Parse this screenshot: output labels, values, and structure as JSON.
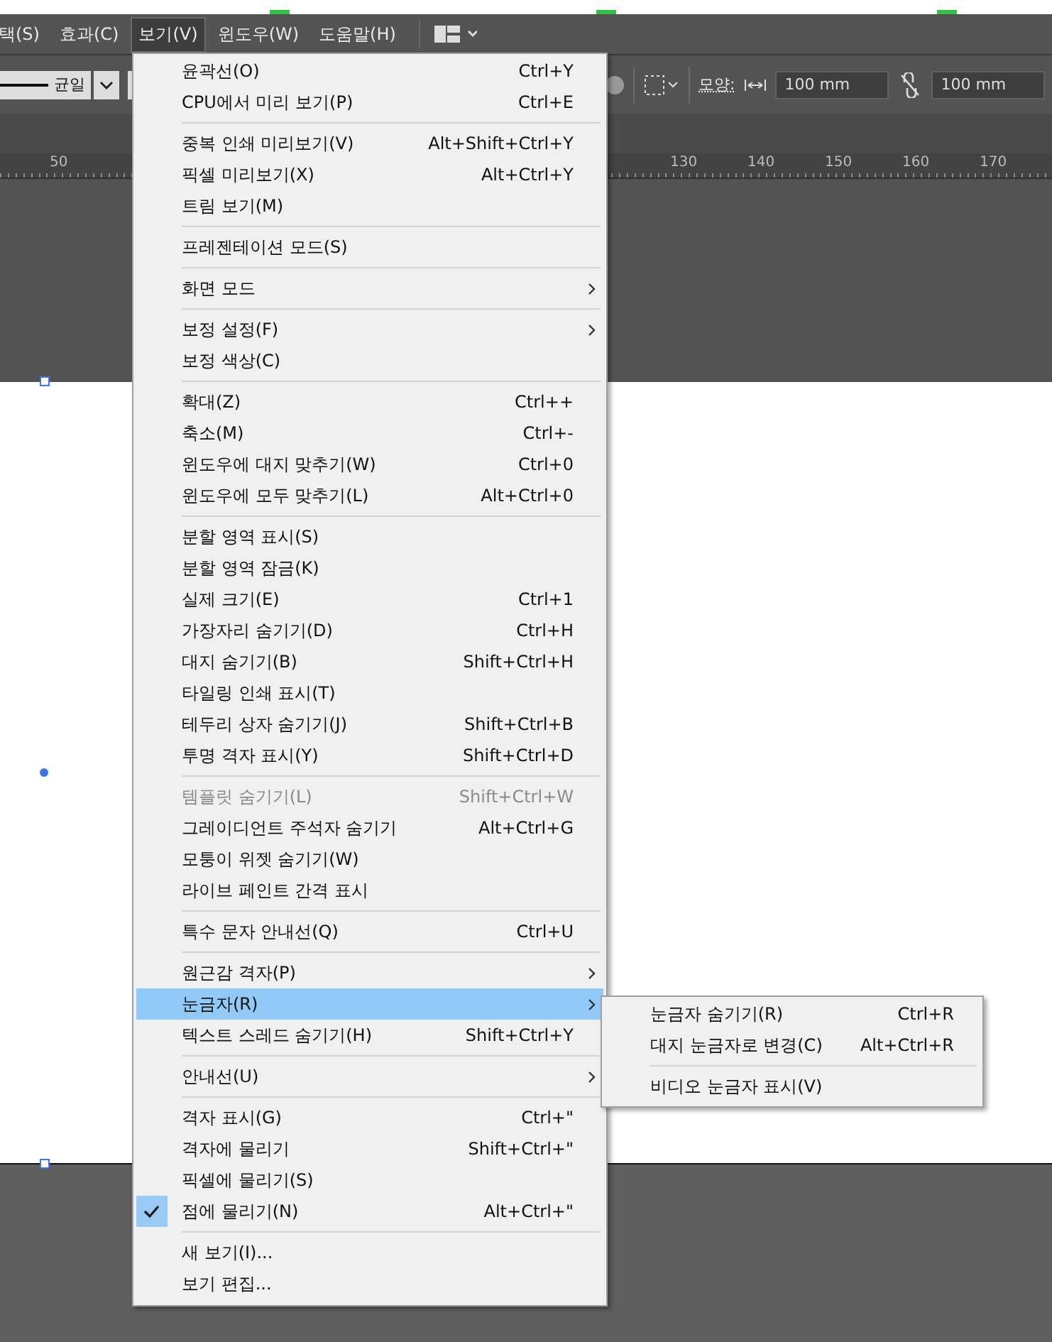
{
  "menubar": [
    {
      "label": "택(S)",
      "selected": false
    },
    {
      "label": "효과(C)",
      "selected": false
    },
    {
      "label": "보기(V)",
      "selected": true
    },
    {
      "label": "윈도우(W)",
      "selected": false
    },
    {
      "label": "도움말(H)",
      "selected": false
    }
  ],
  "toolbar": {
    "stroke_style": "균일",
    "shape_label": "모양:",
    "width_value": "100 mm",
    "height_value": "100 mm"
  },
  "ruler": {
    "labels": [
      "50",
      "130",
      "140",
      "150",
      "160",
      "170"
    ]
  },
  "view_menu": {
    "groups": [
      [
        {
          "label": "윤곽선(O)",
          "shortcut": "Ctrl+Y",
          "submenu": false,
          "disabled": false,
          "checked": false,
          "selected": false
        },
        {
          "label": "CPU에서 미리 보기(P)",
          "shortcut": "Ctrl+E",
          "submenu": false,
          "disabled": false,
          "checked": false,
          "selected": false
        }
      ],
      [
        {
          "label": "중복 인쇄 미리보기(V)",
          "shortcut": "Alt+Shift+Ctrl+Y",
          "submenu": false,
          "disabled": false,
          "checked": false,
          "selected": false
        },
        {
          "label": "픽셀 미리보기(X)",
          "shortcut": "Alt+Ctrl+Y",
          "submenu": false,
          "disabled": false,
          "checked": false,
          "selected": false
        },
        {
          "label": "트림 보기(M)",
          "submenu": false,
          "disabled": false,
          "checked": false,
          "selected": false
        }
      ],
      [
        {
          "label": "프레젠테이션 모드(S)",
          "submenu": false,
          "disabled": false,
          "checked": false,
          "selected": false
        }
      ],
      [
        {
          "label": "화면 모드",
          "submenu": true,
          "disabled": false,
          "checked": false,
          "selected": false
        }
      ],
      [
        {
          "label": "보정 설정(F)",
          "submenu": true,
          "disabled": false,
          "checked": false,
          "selected": false
        },
        {
          "label": "보정 색상(C)",
          "submenu": false,
          "disabled": false,
          "checked": false,
          "selected": false
        }
      ],
      [
        {
          "label": "확대(Z)",
          "shortcut": "Ctrl++",
          "submenu": false,
          "disabled": false,
          "checked": false,
          "selected": false
        },
        {
          "label": "축소(M)",
          "shortcut": "Ctrl+-",
          "submenu": false,
          "disabled": false,
          "checked": false,
          "selected": false
        },
        {
          "label": "윈도우에 대지 맞추기(W)",
          "shortcut": "Ctrl+0",
          "submenu": false,
          "disabled": false,
          "checked": false,
          "selected": false
        },
        {
          "label": "윈도우에 모두 맞추기(L)",
          "shortcut": "Alt+Ctrl+0",
          "submenu": false,
          "disabled": false,
          "checked": false,
          "selected": false
        }
      ],
      [
        {
          "label": "분할 영역 표시(S)",
          "submenu": false,
          "disabled": false,
          "checked": false,
          "selected": false
        },
        {
          "label": "분할 영역 잠금(K)",
          "submenu": false,
          "disabled": false,
          "checked": false,
          "selected": false
        },
        {
          "label": "실제 크기(E)",
          "shortcut": "Ctrl+1",
          "submenu": false,
          "disabled": false,
          "checked": false,
          "selected": false
        },
        {
          "label": "가장자리 숨기기(D)",
          "shortcut": "Ctrl+H",
          "submenu": false,
          "disabled": false,
          "checked": false,
          "selected": false
        },
        {
          "label": "대지 숨기기(B)",
          "shortcut": "Shift+Ctrl+H",
          "submenu": false,
          "disabled": false,
          "checked": false,
          "selected": false
        },
        {
          "label": "타일링 인쇄 표시(T)",
          "submenu": false,
          "disabled": false,
          "checked": false,
          "selected": false
        },
        {
          "label": "테두리 상자 숨기기(J)",
          "shortcut": "Shift+Ctrl+B",
          "submenu": false,
          "disabled": false,
          "checked": false,
          "selected": false
        },
        {
          "label": "투명 격자 표시(Y)",
          "shortcut": "Shift+Ctrl+D",
          "submenu": false,
          "disabled": false,
          "checked": false,
          "selected": false
        }
      ],
      [
        {
          "label": "템플릿 숨기기(L)",
          "shortcut": "Shift+Ctrl+W",
          "submenu": false,
          "disabled": true,
          "checked": false,
          "selected": false
        },
        {
          "label": "그레이디언트 주석자 숨기기",
          "shortcut": "Alt+Ctrl+G",
          "submenu": false,
          "disabled": false,
          "checked": false,
          "selected": false
        },
        {
          "label": "모퉁이 위젯 숨기기(W)",
          "submenu": false,
          "disabled": false,
          "checked": false,
          "selected": false
        },
        {
          "label": "라이브 페인트 간격 표시",
          "submenu": false,
          "disabled": false,
          "checked": false,
          "selected": false
        }
      ],
      [
        {
          "label": "특수 문자 안내선(Q)",
          "shortcut": "Ctrl+U",
          "submenu": false,
          "disabled": false,
          "checked": false,
          "selected": false
        }
      ],
      [
        {
          "label": "원근감 격자(P)",
          "submenu": true,
          "disabled": false,
          "checked": false,
          "selected": false
        },
        {
          "label": "눈금자(R)",
          "submenu": true,
          "disabled": false,
          "checked": false,
          "selected": true
        },
        {
          "label": "텍스트 스레드 숨기기(H)",
          "shortcut": "Shift+Ctrl+Y",
          "submenu": false,
          "disabled": false,
          "checked": false,
          "selected": false
        }
      ],
      [
        {
          "label": "안내선(U)",
          "submenu": true,
          "disabled": false,
          "checked": false,
          "selected": false
        }
      ],
      [
        {
          "label": "격자 표시(G)",
          "shortcut": "Ctrl+\"",
          "submenu": false,
          "disabled": false,
          "checked": false,
          "selected": false
        },
        {
          "label": "격자에 물리기",
          "shortcut": "Shift+Ctrl+\"",
          "submenu": false,
          "disabled": false,
          "checked": false,
          "selected": false
        },
        {
          "label": "픽셀에 물리기(S)",
          "submenu": false,
          "disabled": false,
          "checked": false,
          "selected": false
        },
        {
          "label": "점에 물리기(N)",
          "shortcut": "Alt+Ctrl+\"",
          "submenu": false,
          "disabled": false,
          "checked": true,
          "selected": false
        }
      ],
      [
        {
          "label": "새 보기(I)...",
          "submenu": false,
          "disabled": false,
          "checked": false,
          "selected": false
        },
        {
          "label": "보기 편집...",
          "submenu": false,
          "disabled": false,
          "checked": false,
          "selected": false
        }
      ]
    ]
  },
  "ruler_submenu": {
    "groups": [
      [
        {
          "label": "눈금자 숨기기(R)",
          "shortcut": "Ctrl+R"
        },
        {
          "label": "대지 눈금자로 변경(C)",
          "shortcut": "Alt+Ctrl+R"
        }
      ],
      [
        {
          "label": "비디오 눈금자 표시(V)"
        }
      ]
    ]
  }
}
